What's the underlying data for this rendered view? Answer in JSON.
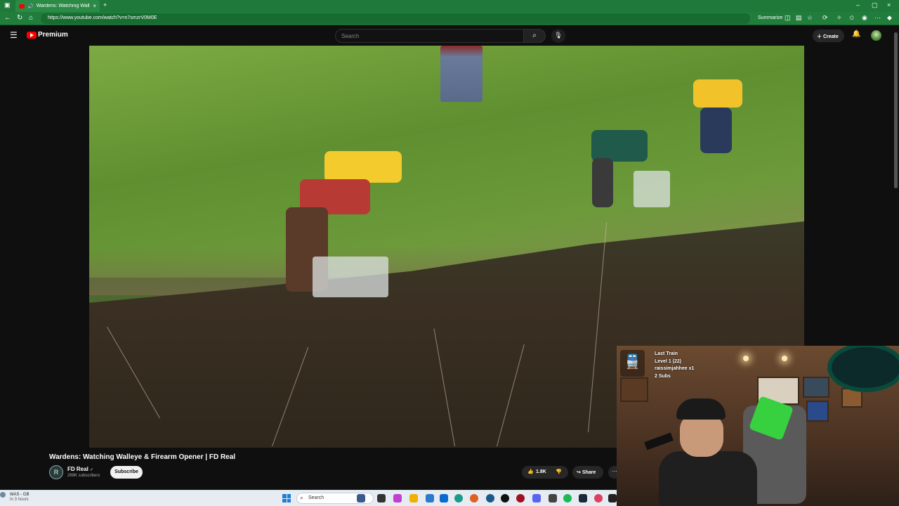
{
  "browser": {
    "tab_title": "Wardens: Watching Walleye",
    "tab_close": "×",
    "new_tab": "+",
    "url": "https://www.youtube.com/watch?v=n7smzrV0M0E",
    "summarize": "Summarize",
    "window_controls": [
      "–",
      "▢",
      "×"
    ]
  },
  "youtube": {
    "brand": "Premium",
    "search_placeholder": "Search",
    "create_label": "Create"
  },
  "video": {
    "title": "Wardens: Watching Walleye & Firearm Opener | FD Real",
    "channel": "FD Real",
    "channel_logo_text": "R",
    "verified_icon": "✓",
    "subscribers": "269K subscribers",
    "subscribe_label": "Subscribe",
    "likes": "1.8K",
    "share_label": "Share"
  },
  "overlay": {
    "line1": "Last Train",
    "line2": "Level 1  (22)",
    "line3": "raissimjahhee x1",
    "line4": "2 Subs"
  },
  "taskbar": {
    "weather_line1": "WAS - GB",
    "weather_line2": "In 3 hours",
    "search_placeholder": "Search"
  },
  "icons": {
    "menu": "hamburger-menu-icon",
    "search": "search-icon",
    "mic": "mic-icon",
    "bell": "notifications-bell-icon",
    "like": "thumbs-up-icon",
    "dislike": "thumbs-down-icon",
    "share": "share-arrow-icon"
  },
  "colors": {
    "browser_green": "#1f7a3a",
    "yt_red": "#ff0000",
    "yt_dark": "#0f0f0f"
  }
}
